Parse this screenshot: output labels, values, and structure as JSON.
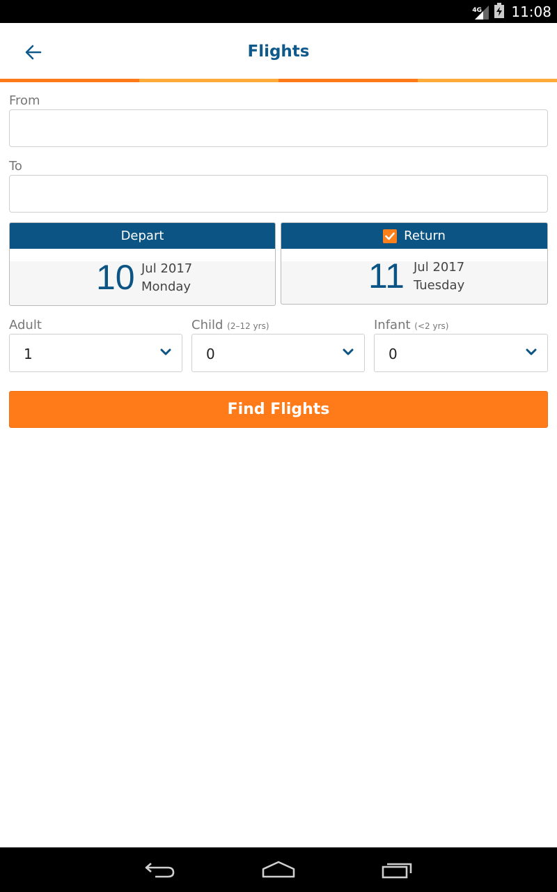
{
  "status_bar": {
    "network": "4G",
    "time": "11:08"
  },
  "header": {
    "title": "Flights"
  },
  "colors": {
    "accent_orange": "#ff7b1a",
    "accent_light_orange": "#ffab3a",
    "primary_blue": "#0b5483"
  },
  "form": {
    "from_label": "From",
    "from_value": "",
    "to_label": "To",
    "to_value": "",
    "depart": {
      "label": "Depart",
      "day": "10",
      "month_year": "Jul 2017",
      "weekday": "Monday"
    },
    "return": {
      "label": "Return",
      "checked": true,
      "day": "11",
      "month_year": "Jul 2017",
      "weekday": "Tuesday"
    },
    "adult": {
      "label": "Adult",
      "value": "1"
    },
    "child": {
      "label": "Child",
      "hint": "(2–12 yrs)",
      "value": "0"
    },
    "infant": {
      "label": "Infant",
      "hint": "(<2 yrs)",
      "value": "0"
    },
    "submit_label": "Find Flights"
  },
  "nav_bar": {
    "icons": [
      "back-icon",
      "home-icon",
      "recents-icon"
    ]
  }
}
